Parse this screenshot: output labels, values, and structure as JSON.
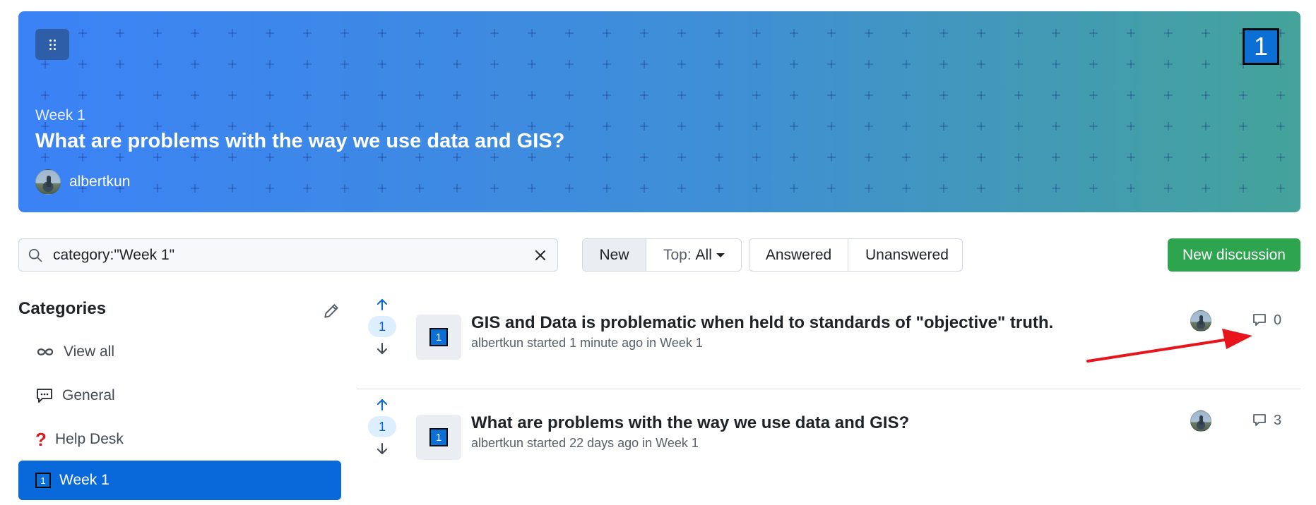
{
  "banner": {
    "category": "Week 1",
    "title": "What are problems with the way we use data and GIS?",
    "author": "albertkun",
    "badge": "1"
  },
  "search": {
    "value": "category:\"Week 1\""
  },
  "sort": {
    "new_label": "New",
    "top_prefix": "Top:",
    "top_value": "All"
  },
  "filter": {
    "answered_label": "Answered",
    "unanswered_label": "Unanswered"
  },
  "new_discussion_label": "New discussion",
  "sidebar": {
    "header": "Categories",
    "items": [
      {
        "label": "View all",
        "icon": "infinity-icon"
      },
      {
        "label": "General",
        "icon": "speech-bubble-icon"
      },
      {
        "label": "Help Desk",
        "icon": "question-mark-icon"
      },
      {
        "label": "Week 1",
        "icon": "keycap-1-icon",
        "badge": "1"
      }
    ]
  },
  "discussions": [
    {
      "votes": "1",
      "badge": "1",
      "title": "GIS and Data is problematic when held to standards of \"objective\" truth.",
      "meta": "albertkun started 1 minute ago in Week 1",
      "comments": "0"
    },
    {
      "votes": "1",
      "badge": "1",
      "title": "What are problems with the way we use data and GIS?",
      "meta": "albertkun started 22 days ago in Week 1",
      "comments": "3"
    }
  ],
  "colors": {
    "primary_blue": "#0a69da",
    "green_button": "#2da44e",
    "annotation_red": "#e8141b",
    "banner_gradient_start": "#3b82f6",
    "banner_gradient_end": "#44a39a"
  }
}
